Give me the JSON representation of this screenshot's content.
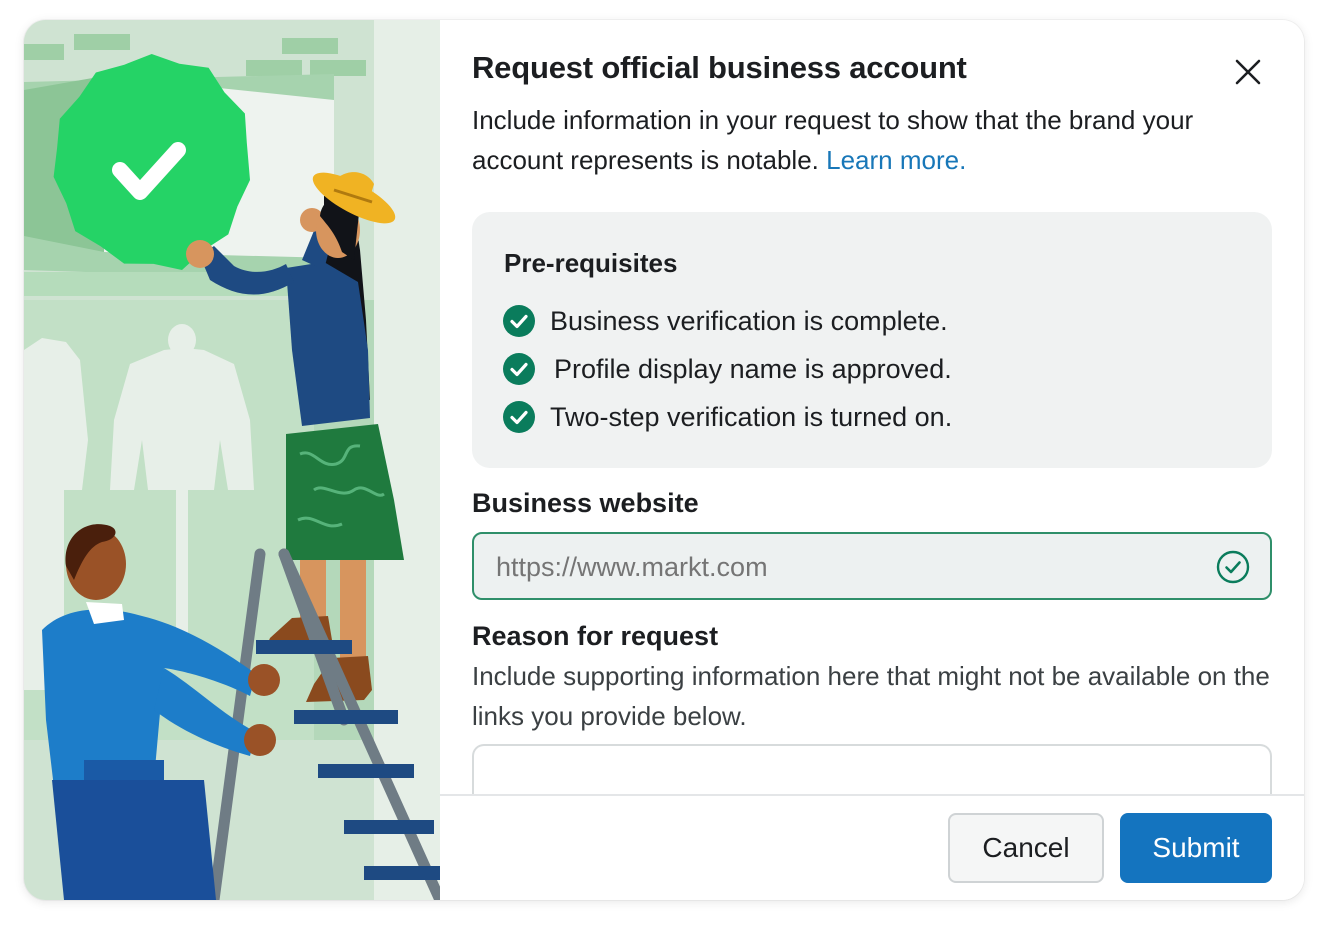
{
  "dialog": {
    "title": "Request official business account",
    "intro_text": "Include information in your request to show that the brand your account represents is notable.",
    "learn_more": "Learn more.",
    "close_icon": "close-icon"
  },
  "prerequisites": {
    "title": "Pre-requisites",
    "items": [
      {
        "label": "Business verification is complete.",
        "icon": "check-circle-icon"
      },
      {
        "label": "Profile display name is approved.",
        "icon": "check-circle-icon"
      },
      {
        "label": "Two-step verification is turned on.",
        "icon": "check-circle-icon"
      }
    ]
  },
  "website": {
    "label": "Business website",
    "placeholder": "https://www.markt.com",
    "value": "",
    "status_icon": "valid-check-icon"
  },
  "reason": {
    "label": "Reason for request",
    "description": "Include supporting information here that might not be available on the links you provide below.",
    "value": ""
  },
  "footer": {
    "cancel_label": "Cancel",
    "submit_label": "Submit"
  },
  "colors": {
    "accent_blue": "#1474bf",
    "link_blue": "#1877b8",
    "success_green": "#0a7c5c",
    "input_border_valid": "#2f8f6a",
    "illustration_bg": "#cfe3d2",
    "badge_green": "#25d366"
  }
}
